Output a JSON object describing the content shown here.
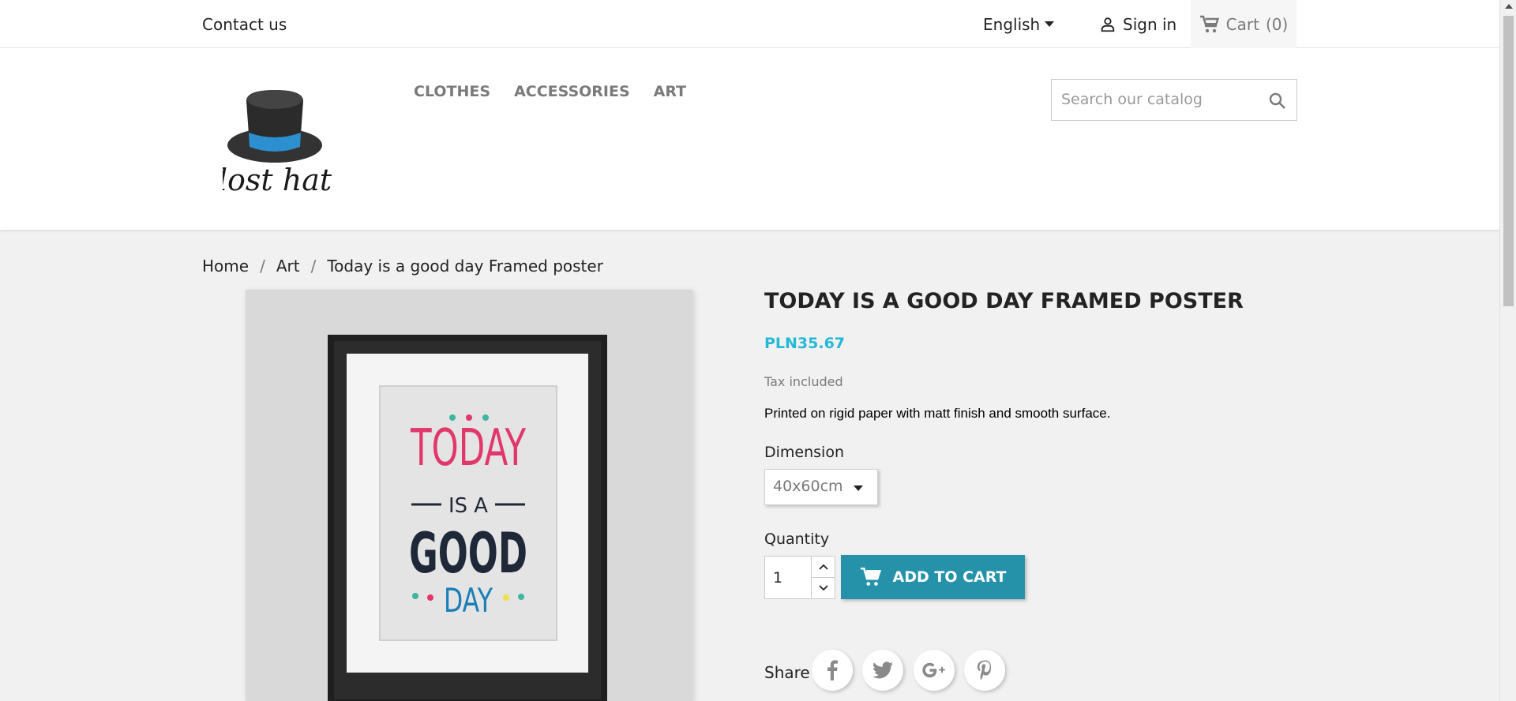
{
  "topbar": {
    "contact_label": "Contact us",
    "language": "English",
    "signin_label": "Sign in",
    "cart_label": "Cart",
    "cart_count": "(0)"
  },
  "header": {
    "logo_text": "lost hat",
    "nav": [
      {
        "label": "CLOTHES"
      },
      {
        "label": "ACCESSORIES"
      },
      {
        "label": "ART"
      }
    ],
    "search_placeholder": "Search our catalog"
  },
  "breadcrumb": [
    "Home",
    "Art",
    "Today is a good day Framed poster"
  ],
  "product": {
    "title": "TODAY IS A GOOD DAY FRAMED POSTER",
    "price": "PLN35.67",
    "tax_note": "Tax included",
    "description": "Printed on rigid paper with matt finish and smooth surface.",
    "dimension_label": "Dimension",
    "dimension_value": "40x60cm",
    "quantity_label": "Quantity",
    "quantity_value": "1",
    "add_to_cart_label": "ADD TO CART",
    "share_label": "Share",
    "poster": {
      "line1": "TODAY",
      "line2": "IS A",
      "line3": "GOOD",
      "line4": "DAY"
    }
  },
  "colors": {
    "accent": "#24b9d7",
    "button": "#2592a9",
    "hat_band": "#2b8fd0",
    "poster_pink": "#e0386a",
    "poster_navy": "#1f2838",
    "poster_blue": "#1b7fb6"
  }
}
